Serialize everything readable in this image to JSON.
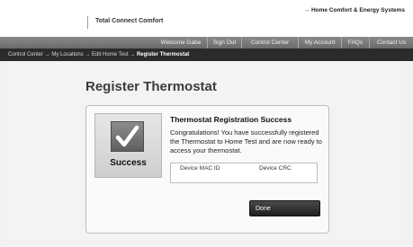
{
  "header": {
    "brand": "Total Connect Comfort",
    "top_link": "→ Home Comfort & Energy Systems"
  },
  "nav": {
    "welcome": "Welcome Gabe",
    "items": [
      {
        "label": "Sign Out"
      },
      {
        "label": "Control Center"
      },
      {
        "label": "My Account"
      },
      {
        "label": "FAQs"
      },
      {
        "label": "Contact Us"
      }
    ]
  },
  "breadcrumb": {
    "path": "Control Center → My Locations → Edit Home Test → ",
    "current": "Register Thermostat"
  },
  "page": {
    "title": "Register Thermostat"
  },
  "status": {
    "label": "Success",
    "icon": "checkmark-icon"
  },
  "registration": {
    "title": "Thermostat Registration Success",
    "message": "Congratulations! You have successfully registered the Thermostat to Home Test and are now ready to access your thermostat."
  },
  "device": {
    "mac_label": "Device MAC ID",
    "crc_label": "Device CRC"
  },
  "actions": {
    "done_label": "Done"
  }
}
